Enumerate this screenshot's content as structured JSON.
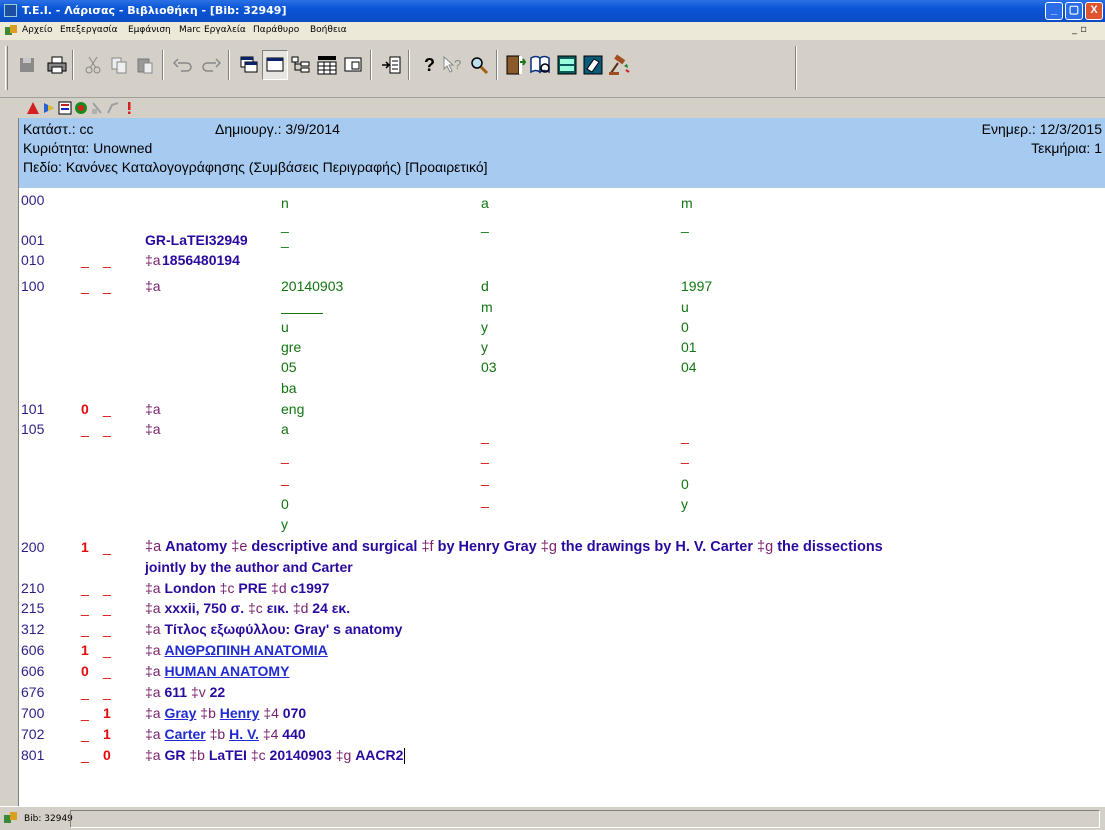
{
  "window": {
    "title": "T.E.I. - Λάρισας - Βιβλιοθήκη - [Bib: 32949]",
    "buttons": {
      "minimize": "_",
      "maximize": "▢",
      "close": "X"
    }
  },
  "menubar": {
    "items": [
      "Αρχείο",
      "Επεξεργασία",
      "Εμφάνιση",
      "Marc",
      "Εργαλεία",
      "Παράθυρο",
      "Βοήθεια"
    ],
    "mdi_controls": "_ ▫"
  },
  "header": {
    "status": "Κατάστ.: cc",
    "created": "Δημιουργ.: 3/9/2014",
    "updated": "Ενημερ.: 12/3/2015",
    "owner": "Κυριότητα: Unowned",
    "items": "Τεκμήρια: 1",
    "field_info": "Πεδίο: Κανόνες Καταλογογράφησης (Συμβάσεις Περιγραφής) [Προαιρετικό]"
  },
  "fields": {
    "000": {
      "tag": "000",
      "v1": "n",
      "v2": "a",
      "v3": "m"
    },
    "001": {
      "tag": "001",
      "value": "GR-LaTEI32949"
    },
    "010": {
      "tag": "010",
      "code": "‡a",
      "value": "1856480194"
    },
    "100": {
      "tag": "100",
      "code": "‡a",
      "r1": [
        "20140903",
        "d",
        "1997"
      ],
      "r2": [
        "",
        "m",
        "u"
      ],
      "r3": [
        "u",
        "y",
        "0"
      ],
      "r4": [
        "gre",
        "y",
        "01"
      ],
      "r5": [
        "05",
        "03",
        "04"
      ],
      "r6": [
        "ba"
      ]
    },
    "101": {
      "tag": "101",
      "ind1": "0",
      "code": "‡a",
      "value": "eng"
    },
    "105": {
      "tag": "105",
      "code": "‡a",
      "v1": "a",
      "v2": "0",
      "v3": "0",
      "v4": "y",
      "v5": "y"
    },
    "200": {
      "tag": "200",
      "ind1": "1",
      "line1": [
        {
          "k": "code",
          "t": "‡a "
        },
        {
          "k": "bold",
          "t": "Anatomy "
        },
        {
          "k": "code",
          "t": "‡e "
        },
        {
          "k": "bold",
          "t": "descriptive and surgical "
        },
        {
          "k": "code",
          "t": "‡f "
        },
        {
          "k": "bold",
          "t": "by Henry Gray "
        },
        {
          "k": "code",
          "t": "‡g "
        },
        {
          "k": "bold",
          "t": "the drawings by H. V. Carter "
        },
        {
          "k": "code",
          "t": "‡g "
        },
        {
          "k": "bold",
          "t": "the dissections"
        }
      ],
      "line2": "jointly by the author and Carter"
    },
    "210": {
      "tag": "210",
      "parts": [
        {
          "k": "code",
          "t": "‡a "
        },
        {
          "k": "bold",
          "t": "London "
        },
        {
          "k": "code",
          "t": "‡c "
        },
        {
          "k": "bold",
          "t": "PRE "
        },
        {
          "k": "code",
          "t": "‡d "
        },
        {
          "k": "bold",
          "t": "c1997"
        }
      ]
    },
    "215": {
      "tag": "215",
      "parts": [
        {
          "k": "code",
          "t": "‡a "
        },
        {
          "k": "bold",
          "t": "xxxii, 750 σ. "
        },
        {
          "k": "code",
          "t": "‡c "
        },
        {
          "k": "bold",
          "t": "εικ. "
        },
        {
          "k": "code",
          "t": "‡d "
        },
        {
          "k": "bold",
          "t": "24 εκ."
        }
      ]
    },
    "312": {
      "tag": "312",
      "parts": [
        {
          "k": "code",
          "t": "‡a "
        },
        {
          "k": "bold",
          "t": "Τίτλος εξωφύλλου: Gray' s anatomy"
        }
      ]
    },
    "606a": {
      "tag": "606",
      "ind1": "1",
      "parts": [
        {
          "k": "code",
          "t": "‡a "
        },
        {
          "k": "link",
          "t": "ΑΝΘΡΩΠΙΝΗ ΑΝΑΤΟΜΙΑ"
        }
      ]
    },
    "606b": {
      "tag": "606",
      "ind1": "0",
      "parts": [
        {
          "k": "code",
          "t": "‡a "
        },
        {
          "k": "link",
          "t": "HUMAN ANATOMY"
        }
      ]
    },
    "676": {
      "tag": "676",
      "parts": [
        {
          "k": "code",
          "t": "‡a "
        },
        {
          "k": "bold",
          "t": "611 "
        },
        {
          "k": "code",
          "t": "‡v "
        },
        {
          "k": "bold",
          "t": "22"
        }
      ]
    },
    "700": {
      "tag": "700",
      "ind2": "1",
      "parts": [
        {
          "k": "code",
          "t": "‡a "
        },
        {
          "k": "link",
          "t": "Gray"
        },
        {
          "k": "bold",
          "t": " "
        },
        {
          "k": "code",
          "t": "‡b "
        },
        {
          "k": "link",
          "t": "Henry"
        },
        {
          "k": "bold",
          "t": " "
        },
        {
          "k": "code",
          "t": "‡4 "
        },
        {
          "k": "bold",
          "t": "070"
        }
      ]
    },
    "702": {
      "tag": "702",
      "ind2": "1",
      "parts": [
        {
          "k": "code",
          "t": "‡a "
        },
        {
          "k": "link",
          "t": "Carter"
        },
        {
          "k": "bold",
          "t": " "
        },
        {
          "k": "code",
          "t": "‡b "
        },
        {
          "k": "link",
          "t": "H. V."
        },
        {
          "k": "bold",
          "t": " "
        },
        {
          "k": "code",
          "t": "‡4 "
        },
        {
          "k": "bold",
          "t": "440"
        }
      ]
    },
    "801": {
      "tag": "801",
      "ind2": "0",
      "parts": [
        {
          "k": "code",
          "t": "‡a "
        },
        {
          "k": "bold",
          "t": "GR "
        },
        {
          "k": "code",
          "t": "‡b "
        },
        {
          "k": "bold",
          "t": "LaTEI "
        },
        {
          "k": "code",
          "t": "‡c "
        },
        {
          "k": "bold",
          "t": "20140903 "
        },
        {
          "k": "code",
          "t": "‡g "
        },
        {
          "k": "bold",
          "t": "AACR2"
        }
      ]
    }
  },
  "blank_indicator": "_",
  "statusbar": {
    "record": "Bib: 32949"
  },
  "colors": {
    "header_band": "#a6caf0",
    "tag": "#2b1f87",
    "indicator": "#e20a0a",
    "subfield": "#7a1f6e",
    "value": "#2a0a9e",
    "fixed": "#117511",
    "link": "#1f2bd0"
  }
}
